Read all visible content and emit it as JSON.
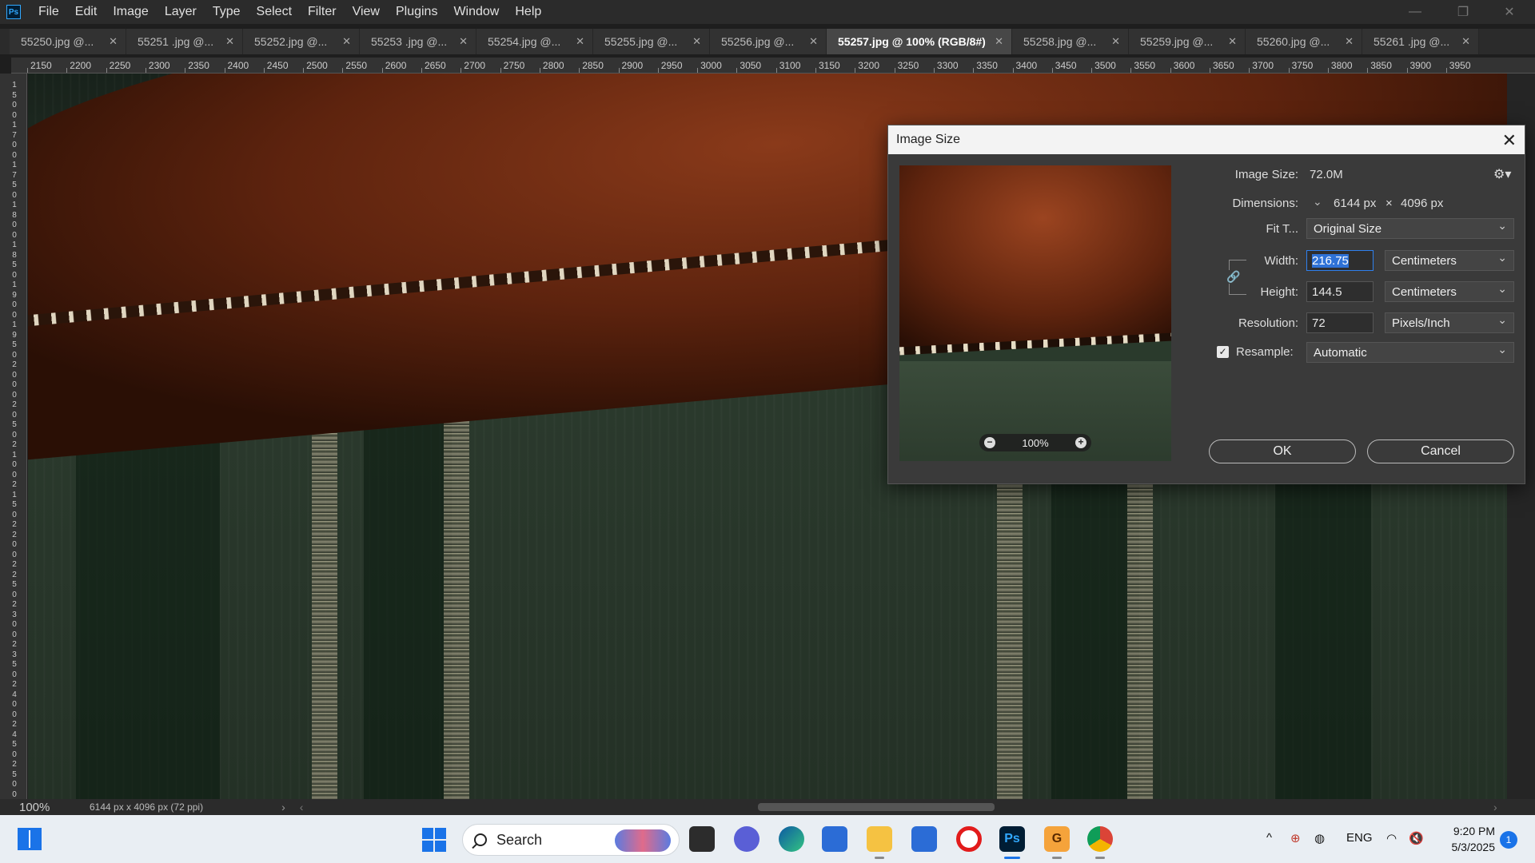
{
  "menu": {
    "app_logo": "Ps",
    "items": [
      "File",
      "Edit",
      "Image",
      "Layer",
      "Type",
      "Select",
      "Filter",
      "View",
      "Plugins",
      "Window",
      "Help"
    ]
  },
  "tabs": [
    {
      "label": "55250.jpg @..."
    },
    {
      "label": "55251 .jpg @..."
    },
    {
      "label": "55252.jpg @..."
    },
    {
      "label": "55253 .jpg @..."
    },
    {
      "label": "55254.jpg @..."
    },
    {
      "label": "55255.jpg @..."
    },
    {
      "label": "55256.jpg @..."
    },
    {
      "label": "55257.jpg @ 100% (RGB/8#)",
      "active": true
    },
    {
      "label": "55258.jpg @..."
    },
    {
      "label": "55259.jpg @..."
    },
    {
      "label": "55260.jpg @..."
    },
    {
      "label": "55261 .jpg @..."
    }
  ],
  "ruler_top": [
    "2150",
    "2200",
    "2250",
    "2300",
    "2350",
    "2400",
    "2450",
    "2500",
    "2550",
    "2600",
    "2650",
    "2700",
    "2750",
    "2800",
    "2850",
    "2900",
    "2950",
    "3000",
    "3050",
    "3100",
    "3150",
    "3200",
    "3250",
    "3300",
    "3350",
    "3400",
    "3450",
    "3500",
    "3550",
    "3600",
    "3650",
    "3700",
    "3750",
    "3800",
    "3850",
    "3900",
    "3950"
  ],
  "ruler_left": [
    "1",
    "5",
    "0",
    "0",
    "1",
    "7",
    "0",
    "0",
    "1",
    "7",
    "5",
    "0",
    "1",
    "8",
    "0",
    "0",
    "1",
    "8",
    "5",
    "0",
    "1",
    "9",
    "0",
    "0",
    "1",
    "9",
    "5",
    "0",
    "2",
    "0",
    "0",
    "0",
    "2",
    "0",
    "5",
    "0",
    "2",
    "1",
    "0",
    "0",
    "2",
    "1",
    "5",
    "0",
    "2",
    "2",
    "0",
    "0",
    "2",
    "2",
    "5",
    "0",
    "2",
    "3",
    "0",
    "0",
    "2",
    "3",
    "5",
    "0",
    "2",
    "4",
    "0",
    "0",
    "2",
    "4",
    "5",
    "0",
    "2",
    "5",
    "0",
    "0"
  ],
  "status": {
    "zoom": "100%",
    "doc_info": "6144 px x 4096 px (72 ppi)"
  },
  "dialog": {
    "title": "Image Size",
    "preview_zoom": "100%",
    "image_size_label": "Image Size:",
    "image_size_value": "72.0M",
    "dimensions_label": "Dimensions:",
    "dim_width": "6144 px",
    "dim_times": "×",
    "dim_height": "4096 px",
    "fit_label": "Fit T...",
    "fit_value": "Original Size",
    "width_label": "Width:",
    "width_value": "216.75",
    "width_unit": "Centimeters",
    "height_label": "Height:",
    "height_value": "144.5",
    "height_unit": "Centimeters",
    "resolution_label": "Resolution:",
    "resolution_value": "72",
    "resolution_unit": "Pixels/Inch",
    "resample_label": "Resample:",
    "resample_checked": true,
    "resample_value": "Automatic",
    "ok_label": "OK",
    "cancel_label": "Cancel"
  },
  "taskbar": {
    "search_label": "Search",
    "language": "ENG",
    "time": "9:20 PM",
    "date": "5/3/2025",
    "notification_count": "1",
    "ps_label": "Ps",
    "brave_label": "G"
  }
}
